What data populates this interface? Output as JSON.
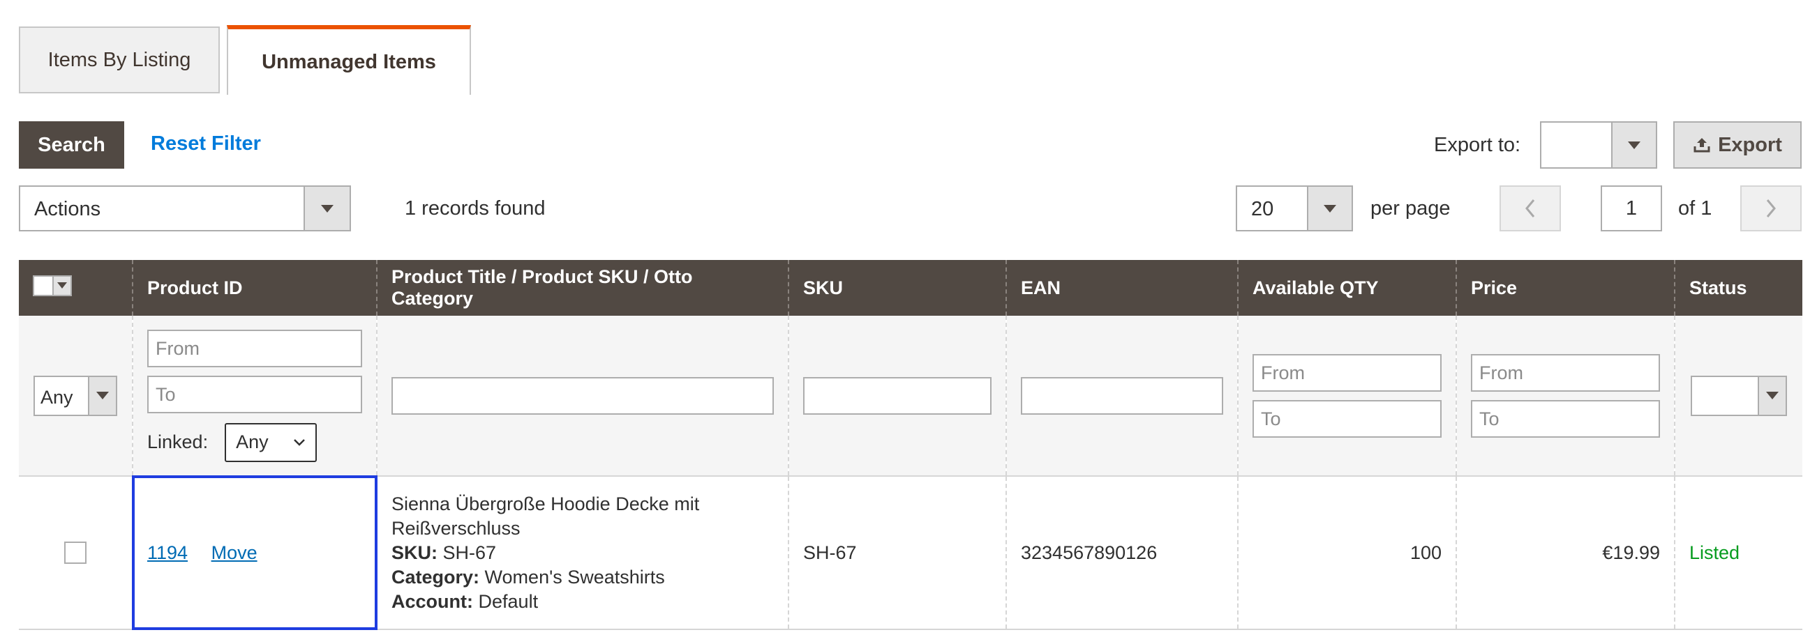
{
  "tabs": [
    {
      "label": "Items By Listing",
      "active": false
    },
    {
      "label": "Unmanaged Items",
      "active": true
    }
  ],
  "toolbar": {
    "search_label": "Search",
    "reset_label": "Reset Filter",
    "export_to_label": "Export to:",
    "export_select_value": "",
    "export_label": "Export",
    "actions_value": "Actions",
    "records_found": "1 records found",
    "per_page_value": "20",
    "per_page_label": "per page",
    "current_page": "1",
    "of_pages": "of 1"
  },
  "grid": {
    "columns": [
      "Product ID",
      "Product Title / Product SKU / Otto Category",
      "SKU",
      "EAN",
      "Available QTY",
      "Price",
      "Status"
    ],
    "filters": {
      "mass_select_value": "Any",
      "product_id_from_placeholder": "From",
      "product_id_to_placeholder": "To",
      "linked_label": "Linked:",
      "linked_value": "Any",
      "qty_from_placeholder": "From",
      "qty_to_placeholder": "To",
      "price_from_placeholder": "From",
      "price_to_placeholder": "To",
      "status_value": ""
    },
    "rows": [
      {
        "product_id": "1194",
        "move_label": "Move",
        "title_line1": "Sienna Übergroße Hoodie Decke mit",
        "title_line2": "Reißverschluss",
        "sku_label": "SKU:",
        "sku_value": "SH-67",
        "category_label": "Category:",
        "category_value": "Women's Sweatshirts",
        "account_label": "Account:",
        "account_value": "Default",
        "sku": "SH-67",
        "ean": "3234567890126",
        "qty": "100",
        "price": "€19.99",
        "status": "Listed"
      }
    ]
  },
  "colors": {
    "header_bg": "#514943",
    "accent_tab": "#eb5202",
    "link": "#007bdb",
    "status_listed": "#079c1f",
    "highlight": "#1f3de0"
  }
}
